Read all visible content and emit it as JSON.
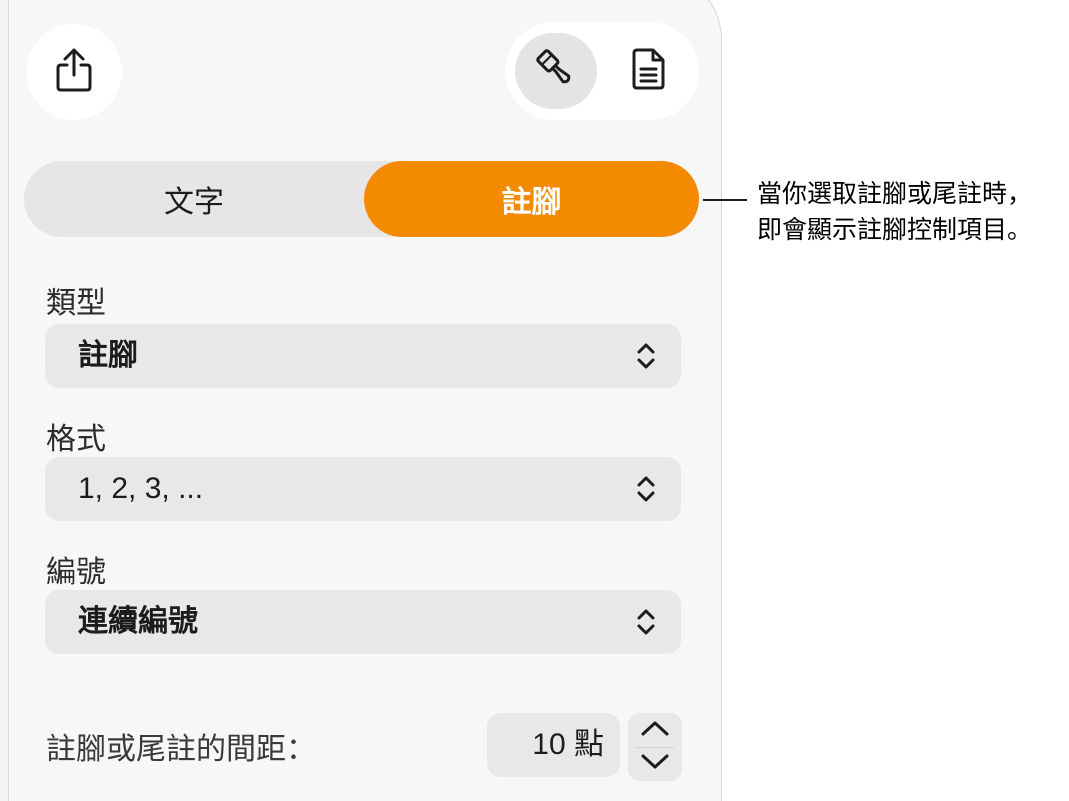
{
  "toolbar": {
    "share_icon": "share-icon",
    "format_icon": "paintbrush-icon",
    "document_icon": "document-icon"
  },
  "tabs": {
    "text_label": "文字",
    "footnote_label": "註腳",
    "active": "註腳",
    "accent_color": "#f48a00"
  },
  "type_section": {
    "label": "類型",
    "value": "註腳"
  },
  "format_section": {
    "label": "格式",
    "value": "1, 2, 3, ..."
  },
  "numbering_section": {
    "label": "編號",
    "value": "連續編號"
  },
  "spacing": {
    "label": "註腳或尾註的間距：",
    "value": "10 點"
  },
  "callout": {
    "line1": "當你選取註腳或尾註時，",
    "line2": "即會顯示註腳控制項目。"
  }
}
